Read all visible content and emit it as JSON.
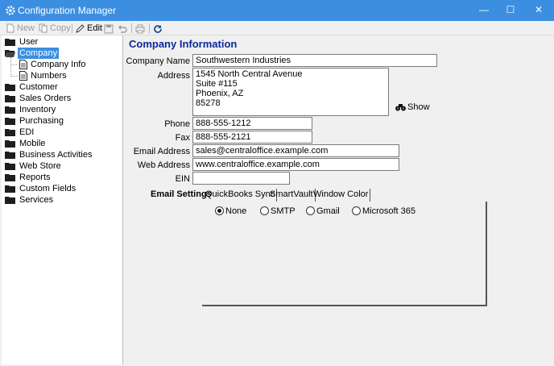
{
  "window": {
    "title": "Configuration Manager"
  },
  "toolbar": {
    "new_label": "New",
    "copy_label": "Copy",
    "edit_label": "Edit"
  },
  "tree": {
    "items": [
      {
        "label": "User"
      },
      {
        "label": "Company",
        "children": [
          {
            "label": "Company Info"
          },
          {
            "label": "Numbers"
          }
        ]
      },
      {
        "label": "Customer"
      },
      {
        "label": "Sales Orders"
      },
      {
        "label": "Inventory"
      },
      {
        "label": "Purchasing"
      },
      {
        "label": "EDI"
      },
      {
        "label": "Mobile"
      },
      {
        "label": "Business Activities"
      },
      {
        "label": "Web Store"
      },
      {
        "label": "Reports"
      },
      {
        "label": "Custom Fields"
      },
      {
        "label": "Services"
      }
    ]
  },
  "form": {
    "section_title": "Company Information",
    "company_name": {
      "label": "Company Name",
      "value": "Southwestern Industries"
    },
    "address": {
      "label": "Address",
      "lines": [
        "1545 North Central Avenue",
        "Suite #115",
        "Phoenix, AZ",
        "85278"
      ]
    },
    "show_label": "Show",
    "phone": {
      "label": "Phone",
      "value": "888-555-1212"
    },
    "fax": {
      "label": "Fax",
      "value": "888-555-2121"
    },
    "email": {
      "label": "Email Address",
      "value": "sales@centraloffice.example.com"
    },
    "web": {
      "label": "Web Address",
      "value": "www.centraloffice.example.com"
    },
    "ein": {
      "label": "EIN",
      "value": ""
    }
  },
  "tabs": [
    {
      "label": "Email Settings",
      "active": true
    },
    {
      "label": "QuickBooks Sync"
    },
    {
      "label": "SmartVault"
    },
    {
      "label": "Window Color"
    }
  ],
  "email_options": [
    {
      "label": "None",
      "selected": true
    },
    {
      "label": "SMTP"
    },
    {
      "label": "Gmail"
    },
    {
      "label": "Microsoft 365"
    }
  ],
  "colors": {
    "titlebar": "#3c8fe0",
    "selection": "#3c8fe0",
    "section_title": "#0a2a9a"
  }
}
